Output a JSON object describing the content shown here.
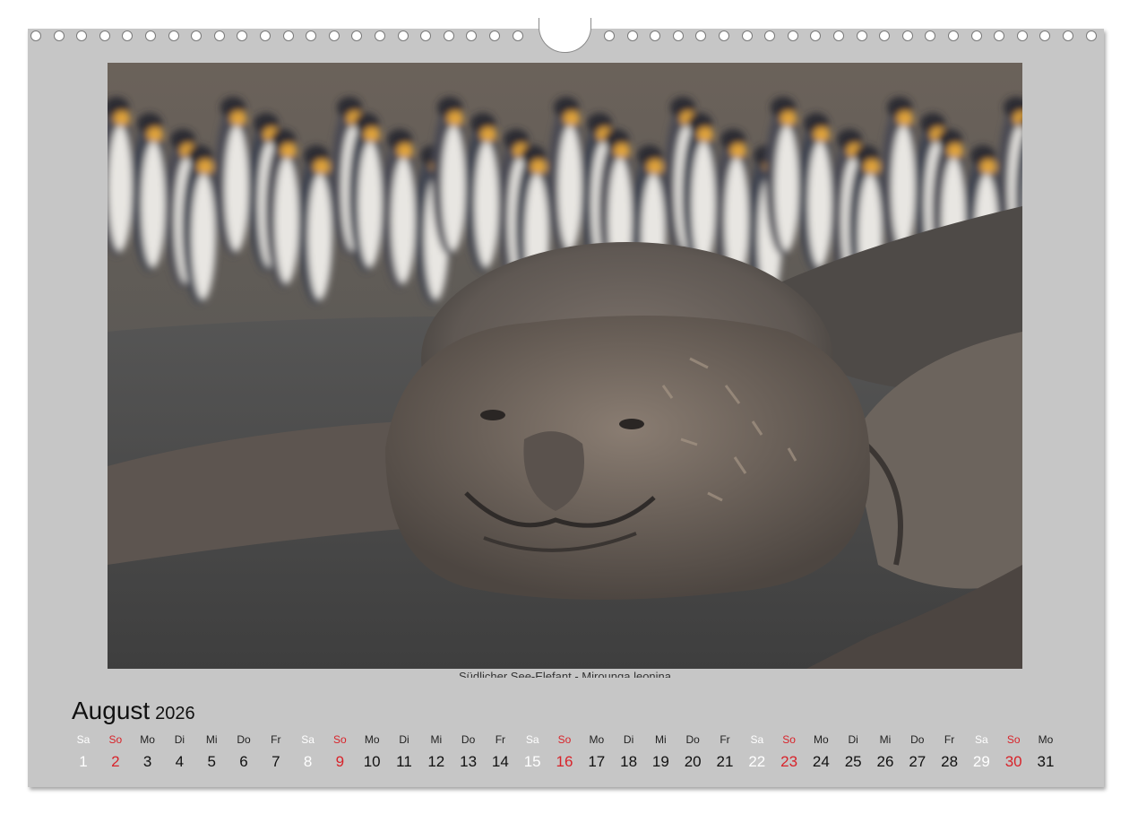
{
  "photo": {
    "subject": "Southern elephant seal lying on dark sand in front of a king penguin colony",
    "caption": "Südlicher See-Elefant - Mirounga leonina"
  },
  "calendar": {
    "month": "August",
    "year": "2026",
    "days": [
      {
        "name": "Sa",
        "num": "1",
        "type": "sat"
      },
      {
        "name": "So",
        "num": "2",
        "type": "sun"
      },
      {
        "name": "Mo",
        "num": "3",
        "type": "week"
      },
      {
        "name": "Di",
        "num": "4",
        "type": "week"
      },
      {
        "name": "Mi",
        "num": "5",
        "type": "week"
      },
      {
        "name": "Do",
        "num": "6",
        "type": "week"
      },
      {
        "name": "Fr",
        "num": "7",
        "type": "week"
      },
      {
        "name": "Sa",
        "num": "8",
        "type": "sat"
      },
      {
        "name": "So",
        "num": "9",
        "type": "sun"
      },
      {
        "name": "Mo",
        "num": "10",
        "type": "week"
      },
      {
        "name": "Di",
        "num": "11",
        "type": "week"
      },
      {
        "name": "Mi",
        "num": "12",
        "type": "week"
      },
      {
        "name": "Do",
        "num": "13",
        "type": "week"
      },
      {
        "name": "Fr",
        "num": "14",
        "type": "week"
      },
      {
        "name": "Sa",
        "num": "15",
        "type": "sat"
      },
      {
        "name": "So",
        "num": "16",
        "type": "sun"
      },
      {
        "name": "Mo",
        "num": "17",
        "type": "week"
      },
      {
        "name": "Di",
        "num": "18",
        "type": "week"
      },
      {
        "name": "Mi",
        "num": "19",
        "type": "week"
      },
      {
        "name": "Do",
        "num": "20",
        "type": "week"
      },
      {
        "name": "Fr",
        "num": "21",
        "type": "week"
      },
      {
        "name": "Sa",
        "num": "22",
        "type": "sat"
      },
      {
        "name": "So",
        "num": "23",
        "type": "sun"
      },
      {
        "name": "Mo",
        "num": "24",
        "type": "week"
      },
      {
        "name": "Di",
        "num": "25",
        "type": "week"
      },
      {
        "name": "Mi",
        "num": "26",
        "type": "week"
      },
      {
        "name": "Do",
        "num": "27",
        "type": "week"
      },
      {
        "name": "Fr",
        "num": "28",
        "type": "week"
      },
      {
        "name": "Sa",
        "num": "29",
        "type": "sat"
      },
      {
        "name": "So",
        "num": "30",
        "type": "sun"
      },
      {
        "name": "Mo",
        "num": "31",
        "type": "week"
      }
    ]
  },
  "colors": {
    "page": "#c6c6c6",
    "sunday": "#d8232a",
    "saturday": "#ffffff"
  }
}
